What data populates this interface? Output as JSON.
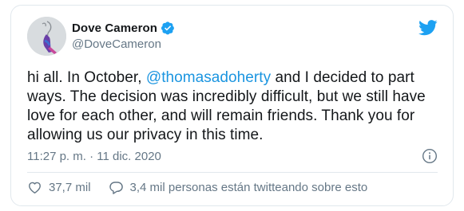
{
  "tweet": {
    "author_name": "Dove Cameron",
    "author_handle": "@DoveCameron",
    "text_before": "hi all. In October, ",
    "mention": "@thomasadoherty",
    "text_after": " and I decided to part ways. The decision was incredibly difficult, but we still have love for each other, and will remain friends. Thank you for allowing us our privacy in this time.",
    "timestamp": "11:27 p. m. · 11 dic. 2020",
    "likes": "37,7 mil",
    "conversation": "3,4 mil personas están twitteando sobre esto"
  },
  "icons": {
    "verified": "verified-badge-icon",
    "brand": "twitter-bird-icon",
    "info": "info-icon",
    "like": "heart-icon",
    "conversation": "speech-bubble-icon"
  },
  "colors": {
    "accent": "#1da1f2",
    "mention": "#1b95e0",
    "secondary_text": "#657786",
    "border": "#e1e8ed"
  }
}
